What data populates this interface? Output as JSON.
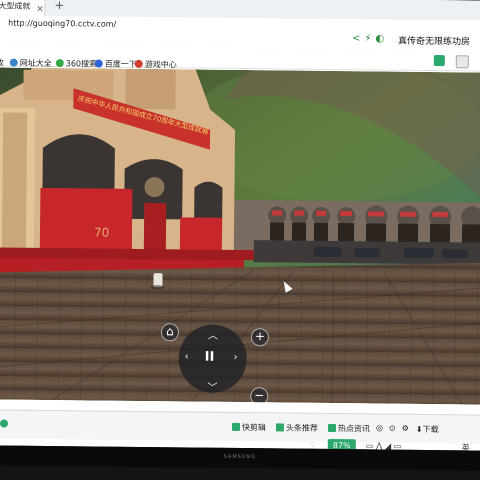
{
  "browser": {
    "tab_title": "大型成就",
    "url": "http://guoqing70.cctv.com/",
    "site_title": "真传奇无限练功房",
    "bookmarks": [
      {
        "label": "网址大全",
        "color": "#3b82c4"
      },
      {
        "label": "360搜索",
        "color": "#35a849"
      },
      {
        "label": "百度一下",
        "color": "#2d64d6"
      },
      {
        "label": "游戏中心",
        "color": "#d43c30"
      }
    ],
    "bookmark_prefix": "收"
  },
  "scene": {
    "banner_text": "庆祝中华人民共和国成立70周年大型成就展",
    "emblem_text": "70"
  },
  "controls": {
    "pause_symbol": "II",
    "zoom_in_symbol": "+",
    "zoom_out_symbol": "−"
  },
  "statusbar": {
    "items": [
      {
        "label": "快剪辑",
        "color": "#2ba86c"
      },
      {
        "label": "头条推荐",
        "color": "#2ba86c"
      },
      {
        "label": "热点资讯",
        "color": "#2ba86c"
      }
    ],
    "download_label": "下载"
  },
  "taskbar": {
    "zoom_level": "87%",
    "lang_label": "英"
  },
  "monitor": {
    "brand": "SAMSUNG"
  }
}
